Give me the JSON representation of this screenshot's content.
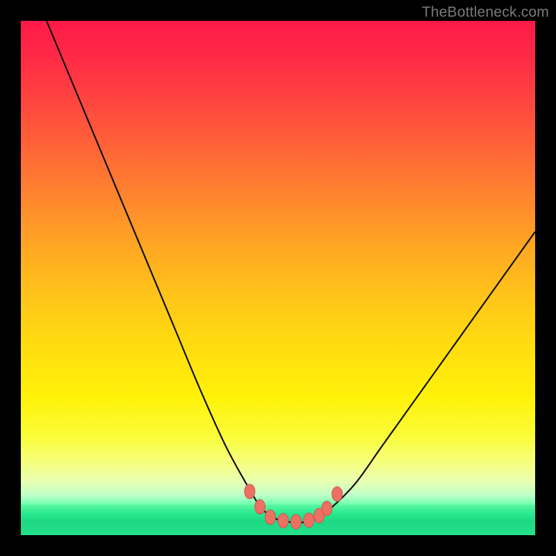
{
  "watermark": "TheBottleneck.com",
  "colors": {
    "frame": "#000000",
    "curve_stroke": "#111111",
    "marker_fill": "#ec7063",
    "marker_stroke": "#c9594e"
  },
  "chart_data": {
    "type": "line",
    "title": "",
    "xlabel": "",
    "ylabel": "",
    "xlim": [
      0,
      100
    ],
    "ylim": [
      0,
      100
    ],
    "grid": false,
    "legend": false,
    "annotations": [],
    "series": [
      {
        "name": "bottleneck-curve",
        "x": [
          5,
          10,
          15,
          20,
          25,
          30,
          35,
          40,
          45,
          47,
          50,
          53,
          55,
          57,
          60,
          65,
          70,
          75,
          80,
          85,
          90,
          95,
          100
        ],
        "y": [
          100,
          88,
          76,
          64,
          52,
          40,
          28,
          17,
          8,
          5,
          3,
          2.5,
          2.5,
          3,
          5,
          10,
          17,
          24,
          31,
          38,
          45,
          52,
          59
        ]
      }
    ],
    "markers": {
      "name": "highlighted-points",
      "x": [
        44.5,
        46.5,
        48.5,
        51,
        53.5,
        56,
        58,
        59.5,
        61.5
      ],
      "y": [
        8.5,
        5.5,
        3.5,
        2.8,
        2.6,
        2.9,
        3.8,
        5.2,
        8.0
      ]
    }
  }
}
